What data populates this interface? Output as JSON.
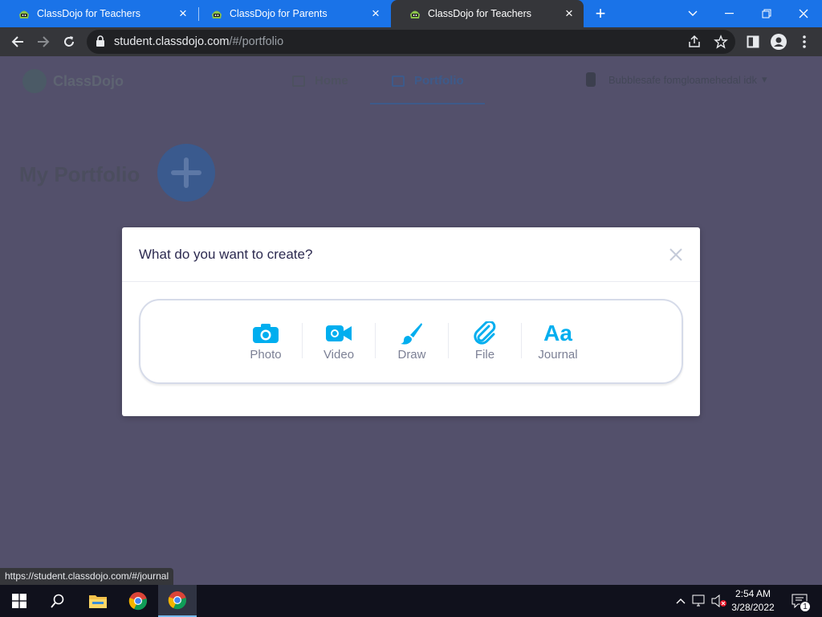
{
  "browser": {
    "tabs": [
      {
        "title": "ClassDojo for Teachers",
        "active": false
      },
      {
        "title": "ClassDojo for Parents",
        "active": false
      },
      {
        "title": "ClassDojo for Teachers",
        "active": true
      }
    ],
    "address": {
      "domain": "student.classdojo.com",
      "path": "/#/portfolio"
    },
    "status_link": "https://student.classdojo.com/#/journal"
  },
  "page": {
    "logo_text": "ClassDojo",
    "nav": [
      {
        "label": "Home"
      },
      {
        "label": "Portfolio"
      }
    ],
    "user_label": "Bubblesafe fomgloamehedal idk",
    "portfolio_title": "My Portfolio"
  },
  "modal": {
    "title": "What do you want to create?",
    "options": [
      {
        "label": "Photo",
        "icon": "camera-icon"
      },
      {
        "label": "Video",
        "icon": "video-camera-icon"
      },
      {
        "label": "Draw",
        "icon": "paintbrush-icon"
      },
      {
        "label": "File",
        "icon": "paperclip-icon"
      },
      {
        "label": "Journal",
        "icon": "text-aa-icon",
        "glyph": "Aa"
      }
    ]
  },
  "taskbar": {
    "time": "2:54 AM",
    "date": "3/28/2022",
    "notification_count": "1"
  },
  "colors": {
    "accent_blue": "#1a73e8",
    "option_blue": "#00aeef",
    "overlay": "#53506b"
  }
}
